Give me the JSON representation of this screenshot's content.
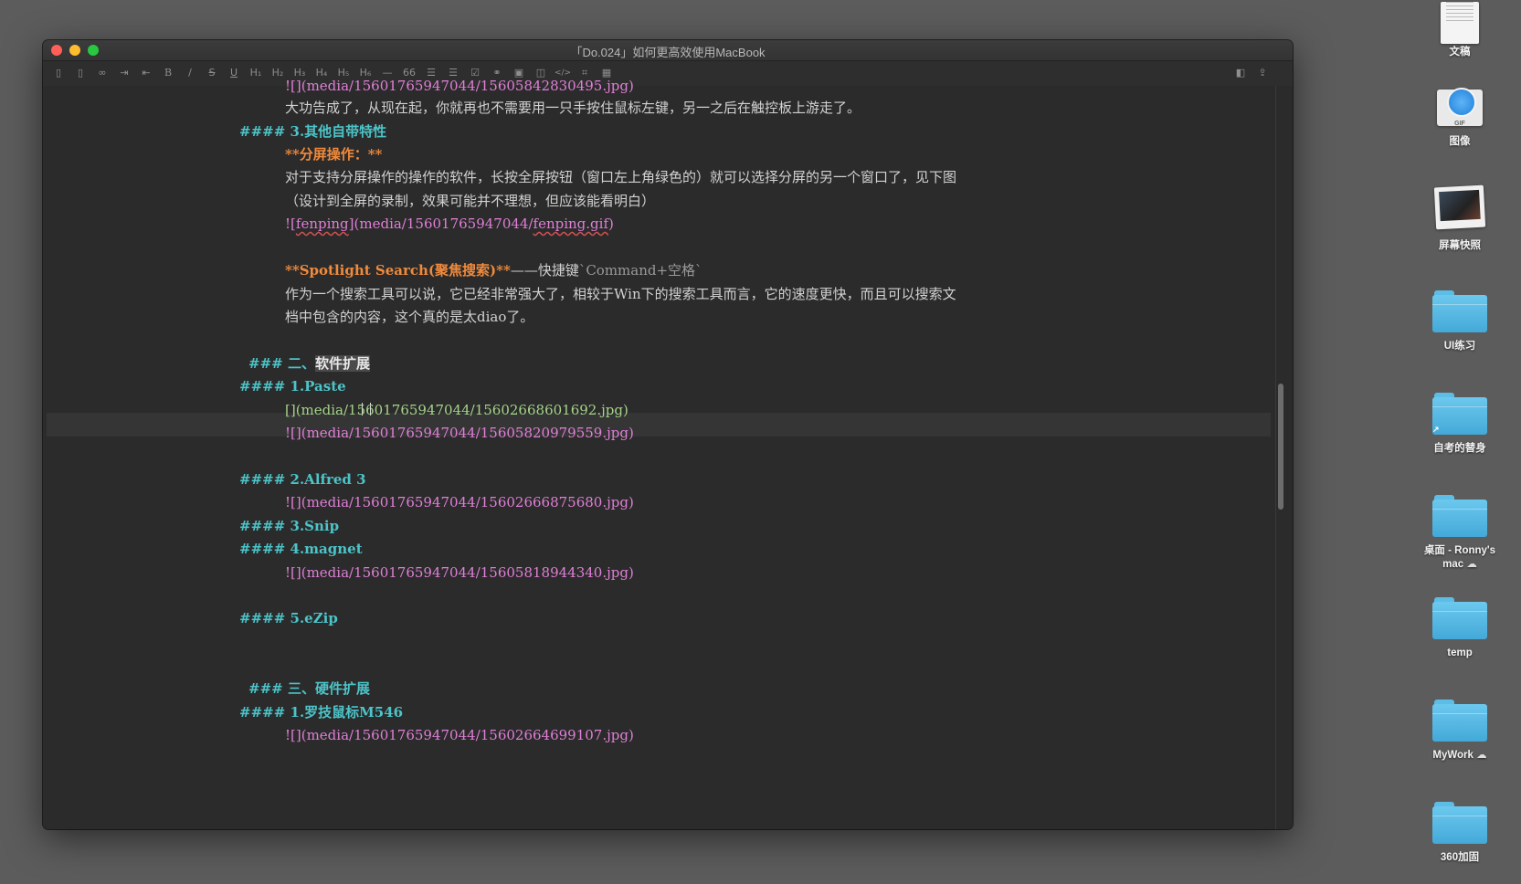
{
  "window": {
    "title": "「Do.024」如何更高效使用MacBook"
  },
  "toolbar": {
    "items": [
      {
        "icon": "sidebar-left-icon",
        "glyph": "▯"
      },
      {
        "icon": "sidebar-right-icon",
        "glyph": "▯"
      },
      {
        "icon": "link-icon",
        "glyph": "∞"
      },
      {
        "icon": "indent-icon",
        "glyph": "⇥"
      },
      {
        "icon": "outdent-icon",
        "glyph": "⇤"
      },
      {
        "icon": "bold-icon",
        "glyph": "B"
      },
      {
        "icon": "italic-icon",
        "glyph": "/"
      },
      {
        "icon": "strikethrough-icon",
        "glyph": "S"
      },
      {
        "icon": "underline-icon",
        "glyph": "U"
      },
      {
        "icon": "h1-icon",
        "glyph": "H₁"
      },
      {
        "icon": "h2-icon",
        "glyph": "H₂"
      },
      {
        "icon": "h3-icon",
        "glyph": "H₃"
      },
      {
        "icon": "h4-icon",
        "glyph": "H₄"
      },
      {
        "icon": "h5-icon",
        "glyph": "H₅"
      },
      {
        "icon": "h6-icon",
        "glyph": "H₆"
      },
      {
        "icon": "horizontal-rule-icon",
        "glyph": "—"
      },
      {
        "icon": "quote-icon",
        "glyph": "66"
      },
      {
        "icon": "ordered-list-icon",
        "glyph": "☰"
      },
      {
        "icon": "unordered-list-icon",
        "glyph": "☰"
      },
      {
        "icon": "task-list-icon",
        "glyph": "☑"
      },
      {
        "icon": "hyperlink-icon",
        "glyph": "⚭"
      },
      {
        "icon": "image-icon",
        "glyph": "▣"
      },
      {
        "icon": "sticker-icon",
        "glyph": "◫"
      },
      {
        "icon": "code-icon",
        "glyph": "</>"
      },
      {
        "icon": "code-block-icon",
        "glyph": "⌗"
      },
      {
        "icon": "table-icon",
        "glyph": "▦"
      }
    ],
    "right": [
      {
        "icon": "preview-pane-icon",
        "glyph": "◧"
      },
      {
        "icon": "share-icon",
        "glyph": "⇪"
      }
    ]
  },
  "editor": {
    "lines": [
      {
        "kind": "img-partial",
        "text": "![](media/15601765947044/15605842830495.jpg)"
      },
      {
        "kind": "text",
        "text": "大功告成了，从现在起，你就再也不需要用一只手按住鼠标左键，另一之后在触控板上游走了。"
      },
      {
        "kind": "h4",
        "marker": "####",
        "text": "3.其他自带特性"
      },
      {
        "kind": "bold",
        "text": "**分屏操作：**"
      },
      {
        "kind": "text",
        "text": "对于支持分屏操作的操作的软件，长按全屏按钮（窗口左上角绿色的）就可以选择分屏的另一个窗口了，见下图"
      },
      {
        "kind": "text",
        "text": "（设计到全屏的录制，效果可能并不理想，但应该能看明白）"
      },
      {
        "kind": "img-fen",
        "a": "![",
        "b": "fenping",
        "c": "](media/15601765947044/",
        "d": "fenping.gif",
        "e": ")"
      },
      {
        "kind": "spot",
        "bold": "**Spotlight Search(聚焦搜索)**",
        "mid": "——快捷键",
        "code": "`Command+空格`"
      },
      {
        "kind": "text",
        "text": "作为一个搜索工具可以说，它已经非常强大了，相较于Win下的搜索工具而言，它的速度更快，而且可以搜索文"
      },
      {
        "kind": "text",
        "text": "档中包含的内容，这个真的是太diao了。"
      },
      {
        "kind": "h3",
        "marker": "###",
        "pre": "二、",
        "sel": "软件扩展"
      },
      {
        "kind": "h4",
        "marker": "####",
        "text": "1.Paste"
      },
      {
        "kind": "link",
        "text": "[](media/15601765947044/15602668601692.jpg)"
      },
      {
        "kind": "img",
        "text": "![](media/15601765947044/15605820979559.jpg)"
      },
      {
        "kind": "h4",
        "marker": "####",
        "text": "2.Alfred 3"
      },
      {
        "kind": "img",
        "text": "![](media/15601765947044/15602666875680.jpg)"
      },
      {
        "kind": "h4",
        "marker": "####",
        "text": "3.Snip"
      },
      {
        "kind": "h4",
        "marker": "####",
        "text": "4.magnet"
      },
      {
        "kind": "img",
        "text": "![](media/15601765947044/15605818944340.jpg)"
      },
      {
        "kind": "h4",
        "marker": "####",
        "text": "5.eZip"
      },
      {
        "kind": "h3",
        "marker": "###",
        "pre": "三、硬件扩展",
        "sel": ""
      },
      {
        "kind": "h4",
        "marker": "####",
        "text": "1.罗技鼠标M546"
      },
      {
        "kind": "img",
        "text": "![](media/15601765947044/15602664699107.jpg)"
      }
    ]
  },
  "desktop": {
    "items": [
      {
        "name": "文稿",
        "type": "doc"
      },
      {
        "name": "图像",
        "type": "safari",
        "badge": "GIF"
      },
      {
        "name": "屏幕快照",
        "type": "screenshot"
      },
      {
        "name": "UI练习",
        "type": "folder"
      },
      {
        "name": "自考的替身",
        "type": "folder-alias"
      },
      {
        "name": "桌面 - Ronny's mac",
        "type": "folder",
        "cloud": "☁"
      },
      {
        "name": "temp",
        "type": "folder"
      },
      {
        "name": "MyWork",
        "type": "folder",
        "cloud": "☁"
      },
      {
        "name": "360加固",
        "type": "folder"
      }
    ]
  }
}
